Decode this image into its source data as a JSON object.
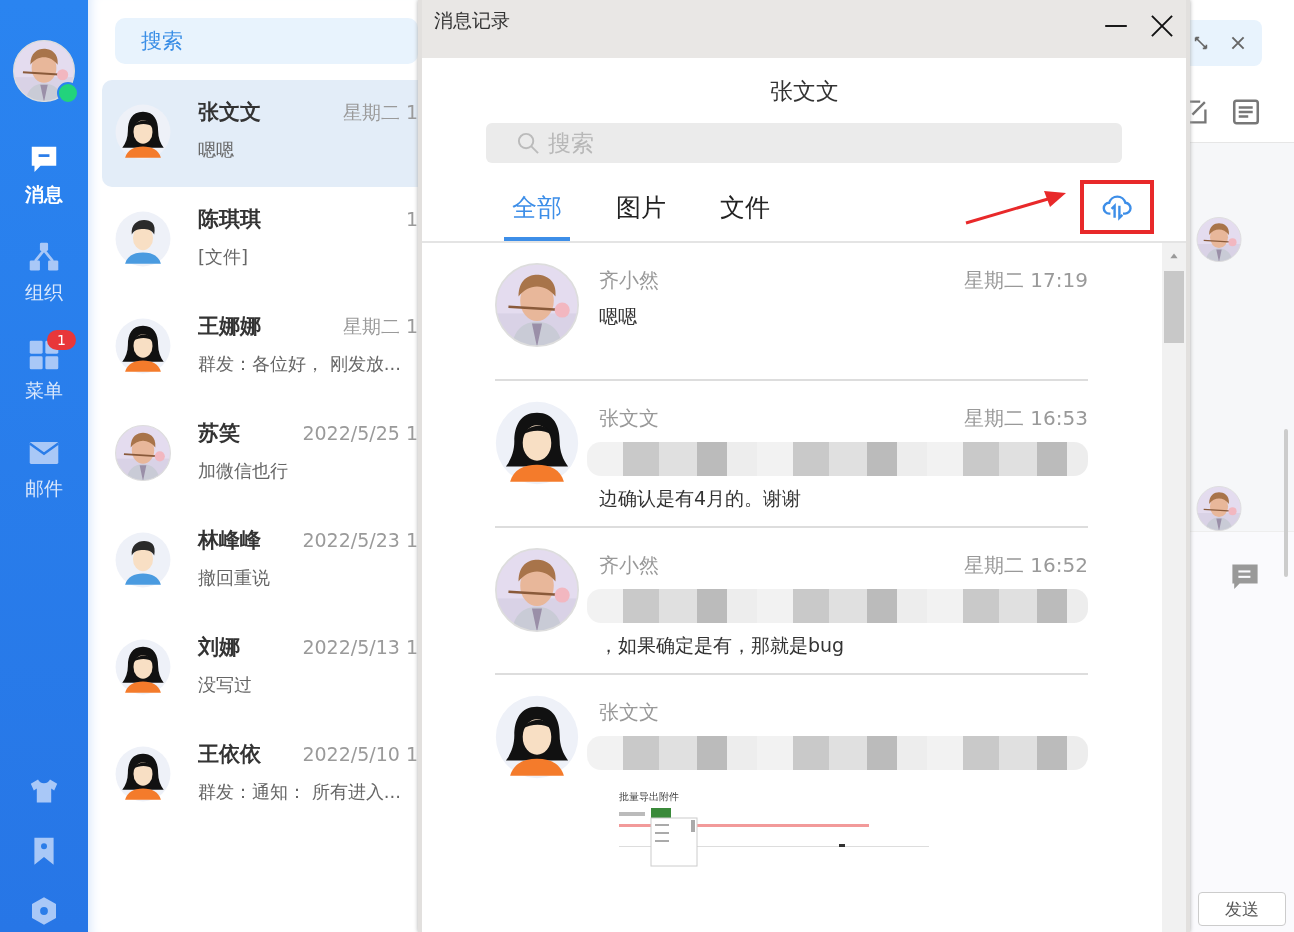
{
  "sidebar": {
    "online": true,
    "items": [
      {
        "label": "消息",
        "kind": "chat",
        "selected": true
      },
      {
        "label": "组织",
        "kind": "org",
        "selected": false
      },
      {
        "label": "菜单",
        "kind": "grid",
        "selected": false,
        "badge": "1"
      },
      {
        "label": "邮件",
        "kind": "mail",
        "selected": false
      }
    ],
    "bottom_icons": [
      {
        "kind": "shirt"
      },
      {
        "kind": "bookmark"
      },
      {
        "kind": "hexagon"
      }
    ]
  },
  "chat_list": {
    "search_placeholder": "搜索",
    "chats": [
      {
        "name": "张文文",
        "preview": "嗯嗯",
        "time": "星期二 1",
        "kind": "girl",
        "selected": true
      },
      {
        "name": "陈琪琪",
        "preview": "[文件]",
        "time": "1",
        "kind": "boy",
        "selected": false
      },
      {
        "name": "王娜娜",
        "preview": "群发：各位好， 刚发放...",
        "time": "星期二 1",
        "kind": "girl",
        "selected": false
      },
      {
        "name": "苏笑",
        "preview": "加微信也行",
        "time": "2022/5/25 1",
        "selected": false
      },
      {
        "name": "林峰峰",
        "preview": "撤回重说",
        "time": "2022/5/23 1",
        "kind": "boy",
        "selected": false
      },
      {
        "name": "刘娜",
        "preview": "没写过",
        "time": "2022/5/13 1",
        "kind": "girl",
        "selected": false
      },
      {
        "name": "王依依",
        "preview": "群发：通知： 所有进入...",
        "time": "2022/5/10 1",
        "kind": "girl",
        "selected": false
      }
    ]
  },
  "history_window": {
    "title": "消息记录",
    "contact": "张文文",
    "search_placeholder": "搜索",
    "tabs": [
      {
        "label": "全部",
        "selected": true
      },
      {
        "label": "图片",
        "selected": false
      },
      {
        "label": "文件",
        "selected": false
      }
    ],
    "export_highlighted": true,
    "messages": [
      {
        "sender": "齐小然",
        "time": "星期二 17:19",
        "text": "嗯嗯",
        "redacted": false
      },
      {
        "sender": "张文文",
        "time": "星期二 16:53",
        "text": "边确认是有4月的。谢谢",
        "kind": "girl",
        "redacted": true
      },
      {
        "sender": "齐小然",
        "time": "星期二 16:52",
        "text": "，如果确定是有，那就是bug",
        "redacted": true
      },
      {
        "sender": "张文文",
        "kind": "girl",
        "redacted": true,
        "attachment": {
          "kind": "screenshot",
          "title": "批量导出附件"
        }
      }
    ]
  },
  "main_chat": {
    "send_label": "发送"
  }
}
